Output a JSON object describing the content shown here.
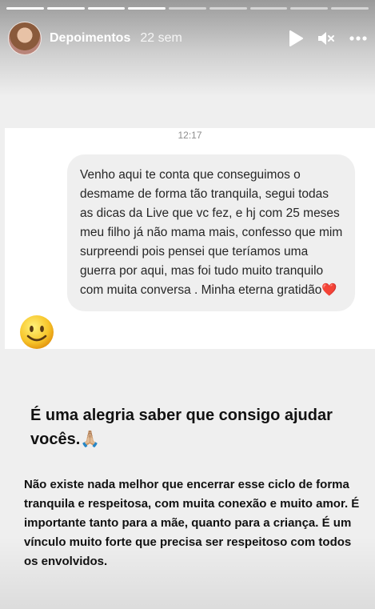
{
  "story": {
    "progress_segments": 9,
    "progress_current": 4,
    "username": "Depoimentos",
    "posted_ago": "22 sem"
  },
  "icons": {
    "play": "play-icon",
    "mute": "speaker-muted-icon",
    "more": "more-options-icon",
    "emoji": "smiling-face-emoji"
  },
  "chat": {
    "time": "12:17",
    "message": "Venho aqui te conta que conseguimos o desmame de forma tão tranquila, segui todas as dicas da Live que vc fez, e hj com 25 meses meu filho já não mama mais, confesso que mim surpreendi pois pensei que teríamos uma guerra por aqui, mas foi tudo muito tranquilo com muita conversa . Minha eterna gratidão❤️"
  },
  "caption": {
    "title": "É  uma alegria saber que consigo ajudar vocês.🙏🏼",
    "body": "Não existe nada melhor que encerrar esse ciclo de forma tranquila e respeitosa, com muita conexão e muito amor.  É  importante tanto para a mãe, quanto para a criança. É um vínculo muito forte que precisa ser respeitoso com todos os envolvidos."
  }
}
